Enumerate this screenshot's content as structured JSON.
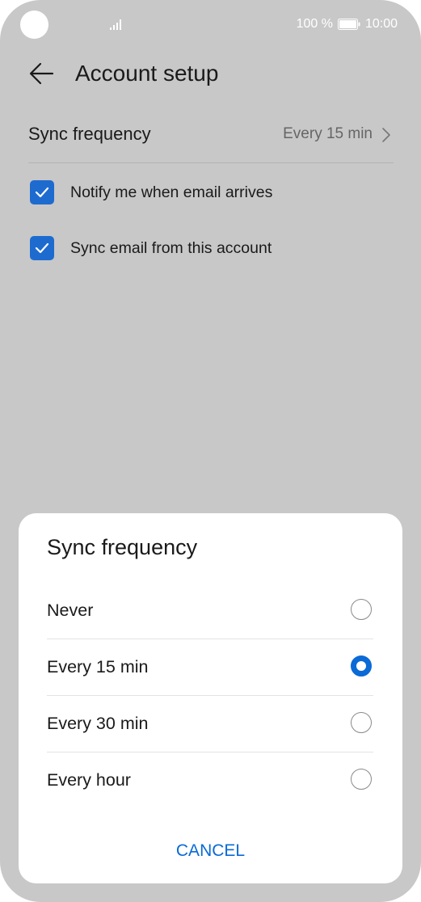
{
  "status_bar": {
    "battery_percent": "100 %",
    "time": "10:00",
    "battery_level": 1.0
  },
  "header": {
    "title": "Account setup"
  },
  "settings": {
    "sync_frequency_label": "Sync frequency",
    "sync_frequency_value": "Every 15 min",
    "notify_label": "Notify me when email arrives",
    "notify_checked": true,
    "sync_email_label": "Sync email from this account",
    "sync_email_checked": true
  },
  "dialog": {
    "title": "Sync frequency",
    "options": [
      {
        "label": "Never",
        "selected": false
      },
      {
        "label": "Every 15 min",
        "selected": true
      },
      {
        "label": "Every 30 min",
        "selected": false
      },
      {
        "label": "Every hour",
        "selected": false
      }
    ],
    "cancel_label": "CANCEL"
  },
  "colors": {
    "accent": "#0a6ad6",
    "checkbox": "#1e6bd0",
    "scrim_background": "#c8c8c8"
  }
}
